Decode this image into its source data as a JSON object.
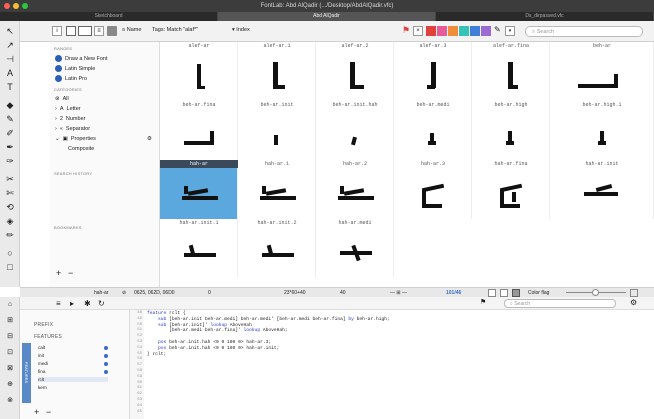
{
  "window": {
    "title": "FontLab: Abd AlQadir (.../Desktop/AbdAlQadir.vfc)",
    "tabs": [
      "Sketchboard",
      "Abd AlQadir",
      "Ds_dirpassed.vfc"
    ]
  },
  "toolbar": {
    "name_label": "Name",
    "tags_label": "Tags: Match \"alaf*\"",
    "index_label": "Index",
    "search_placeholder": "Search"
  },
  "sidebar": {
    "ranges_header": "RANGES",
    "ranges": [
      "Draw a New Font",
      "Latin Simple",
      "Latin Pro"
    ],
    "categories_header": "CATEGORIES",
    "categories": [
      "All",
      "Letter",
      "Number",
      "Separator",
      "Properties",
      "Composite"
    ],
    "history_header": "SEARCH HISTORY",
    "bookmarks_header": "BOOKMARKS",
    "add_button": "+",
    "remove_button": "−"
  },
  "glyphs": [
    {
      "name": "alef-ar"
    },
    {
      "name": "alef-ar.1"
    },
    {
      "name": "alef-ar.2"
    },
    {
      "name": "alef-ar.3"
    },
    {
      "name": "alef-ar.fina"
    },
    {
      "name": "beh-ar"
    },
    {
      "name": "beh-ar.fina"
    },
    {
      "name": "beh-ar.init"
    },
    {
      "name": "beh-ar.init.hah"
    },
    {
      "name": "beh-ar.medi"
    },
    {
      "name": "beh-ar.high"
    },
    {
      "name": "beh-ar.high.1"
    },
    {
      "name": "hah-ar",
      "selected": true
    },
    {
      "name": "hah-ar.1"
    },
    {
      "name": "hah-ar.2"
    },
    {
      "name": "hah-ar.3"
    },
    {
      "name": "hah-ar.fina"
    },
    {
      "name": "hah-ar.init"
    },
    {
      "name": "hah-ar.init.1"
    },
    {
      "name": "hah-ar.init.2"
    },
    {
      "name": "hah-ar.medi"
    }
  ],
  "statusbar": {
    "glyph": "hah-ar",
    "unicode": "0625, 062D, 06D0",
    "width": "0",
    "kerning": "23*60+40",
    "metrics": "40",
    "count": "101/46",
    "color_flag": "Color flag"
  },
  "features": {
    "prefix_label": "PREFIX",
    "features_label": "FEATURES",
    "vertical_tab": "FEATURES",
    "list": [
      "calt",
      "init",
      "medi",
      "fina",
      "rclt",
      "kern"
    ],
    "search_placeholder": "Search",
    "add_button": "+",
    "remove_button": "−",
    "line_numbers": [
      "48",
      "49",
      "50",
      "51",
      "52",
      "53",
      "54",
      "55",
      "56",
      "57",
      "58",
      "59",
      "60",
      "61",
      "62",
      "63",
      "64",
      "65"
    ],
    "code_lines": [
      "feature rclt {",
      "    sub [beh-ar.init beh-ar.medi] beh-ar.medi' [beh-ar.medi beh-ar.fina] by beh-ar.high;",
      "    sub [beh-ar.init]' lookup AboveHah",
      "        [beh-ar.medi beh-ar.fina]' lookup AboveHah;",
      "",
      "    pos beh-ar.init.hah <0 0 180 0> hah-ar.3;",
      "    pos beh-ar.init.hah <0 0 160 0> hah-ar.init;",
      "} rclt;"
    ]
  },
  "colors": {
    "selection": "#5aa8dd",
    "flag_red": "#e0413a",
    "flag_pink": "#e75a9a",
    "flag_orange": "#f08c3a",
    "flag_teal": "#37c2b7",
    "flag_blue": "#3f7fd8",
    "flag_purple": "#9c6ad3",
    "flag_yellow": "#f0c94a"
  }
}
